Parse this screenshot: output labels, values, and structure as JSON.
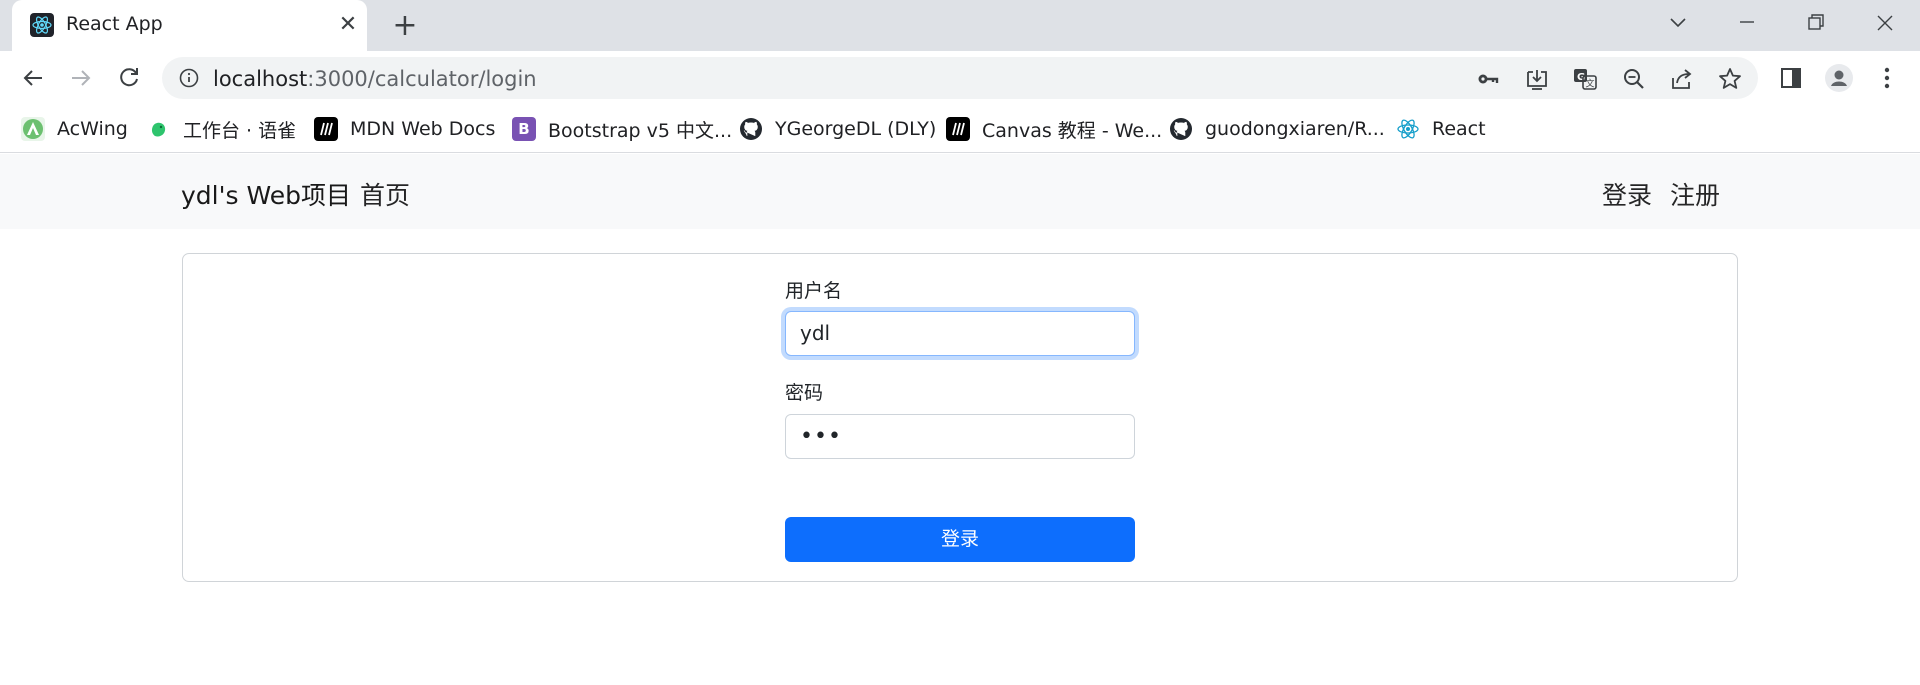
{
  "browser": {
    "tab": {
      "title": "React App",
      "favicon": "react-icon"
    },
    "url": {
      "host": "localhost",
      "path": ":3000/calculator/login"
    },
    "bookmarks": [
      {
        "label": "AcWing",
        "icon": "acwing-icon",
        "color": "#5cb85c"
      },
      {
        "label": "工作台 · 语雀",
        "icon": "yuque-icon",
        "color": "#2ec46d"
      },
      {
        "label": "MDN Web Docs",
        "icon": "mdn-icon",
        "color": "#000000"
      },
      {
        "label": "Bootstrap v5 中文...",
        "icon": "bootstrap-icon",
        "color": "#7952b3"
      },
      {
        "label": "YGeorgeDL (DLY)",
        "icon": "github-icon",
        "color": "#24292f"
      },
      {
        "label": "Canvas 教程 - We...",
        "icon": "mdn-icon",
        "color": "#000000"
      },
      {
        "label": "guodongxiaren/R...",
        "icon": "github-icon",
        "color": "#24292f"
      },
      {
        "label": "React",
        "icon": "react-icon",
        "color": "#149eca"
      }
    ]
  },
  "navbar": {
    "brand": "ydl's Web项目",
    "home": "首页",
    "login": "登录",
    "register": "注册"
  },
  "form": {
    "username_label": "用户名",
    "username_value": "ydl",
    "password_label": "密码",
    "password_masked": "•••",
    "submit_label": "登录"
  },
  "colors": {
    "primary": "#0d6efd",
    "focus_ring": "#86b7fe",
    "navbar_bg": "#f8f9fa"
  }
}
